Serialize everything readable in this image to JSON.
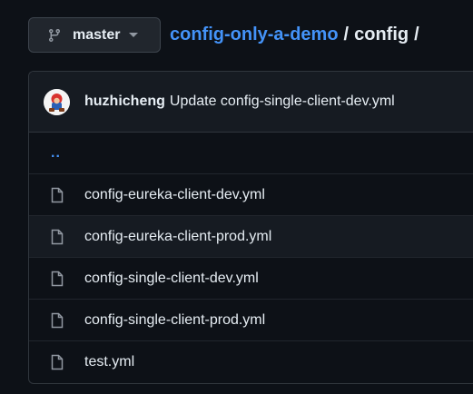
{
  "branch": {
    "label": "master",
    "icon": "git-branch-icon",
    "caret_icon": "triangle-down-icon"
  },
  "breadcrumb": {
    "repo": "config-only-a-demo",
    "separator": "/",
    "folder": "config",
    "trailing": "/"
  },
  "latest_commit": {
    "author": "huzhicheng",
    "message": "Update config-single-client-dev.yml"
  },
  "parent_link": "..",
  "files": [
    {
      "name": "config-eureka-client-dev.yml",
      "icon": "file-icon"
    },
    {
      "name": "config-eureka-client-prod.yml",
      "icon": "file-icon"
    },
    {
      "name": "config-single-client-dev.yml",
      "icon": "file-icon"
    },
    {
      "name": "config-single-client-prod.yml",
      "icon": "file-icon"
    },
    {
      "name": "test.yml",
      "icon": "file-icon"
    }
  ],
  "colors": {
    "background": "#0d1117",
    "link": "#4493f8",
    "text": "#e6edf3",
    "border": "#30363d"
  }
}
